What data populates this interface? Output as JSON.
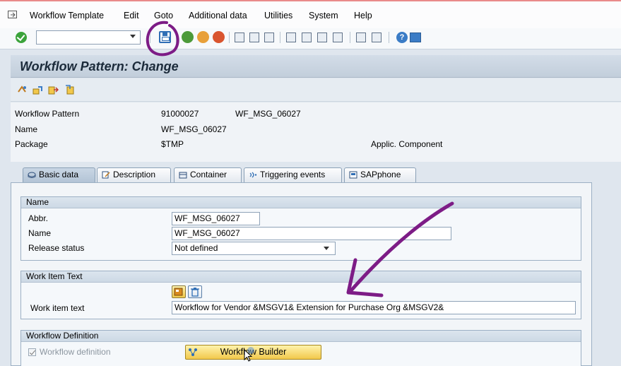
{
  "menubar": {
    "items": [
      "Workflow Template",
      "Edit",
      "Goto",
      "Additional data",
      "Utilities",
      "System",
      "Help"
    ]
  },
  "toolbar": {
    "command_field_value": "",
    "icons": [
      "enter-icon",
      "save-icon",
      "back-icon",
      "exit-icon",
      "cancel-icon",
      "print-icon",
      "find-icon",
      "find-next-icon",
      "first-page-icon",
      "previous-page-icon",
      "next-page-icon",
      "last-page-icon",
      "create-session-icon",
      "shortcut-icon",
      "help-icon",
      "layout-icon"
    ]
  },
  "title": "Workflow Pattern: Change",
  "header": {
    "workflow_pattern_label": "Workflow Pattern",
    "workflow_pattern_id": "91000027",
    "workflow_pattern_abbr": "WF_MSG_06027",
    "name_label": "Name",
    "name_value": "WF_MSG_06027",
    "package_label": "Package",
    "package_value": "$TMP",
    "applic_component_label": "Applic. Component"
  },
  "tabs": [
    {
      "label": "Basic data",
      "active": true
    },
    {
      "label": "Description",
      "active": false
    },
    {
      "label": "Container",
      "active": false
    },
    {
      "label": "Triggering events",
      "active": false
    },
    {
      "label": "SAPphone",
      "active": false
    }
  ],
  "name_group": {
    "title": "Name",
    "abbr_label": "Abbr.",
    "abbr_value": "WF_MSG_06027",
    "name_label": "Name",
    "name_value": "WF_MSG_06027",
    "release_status_label": "Release status",
    "release_status_value": "Not defined"
  },
  "work_item_group": {
    "title": "Work Item Text",
    "work_item_text_label": "Work item text",
    "work_item_text_value": "Workflow for Vendor &MSGV1& Extension for Purchase Org &MSGV2&"
  },
  "workflow_def_group": {
    "title": "Workflow Definition",
    "checkbox_label": "Workflow definition",
    "checkbox_checked": true,
    "builder_button_label": "Workflow Builder"
  },
  "colors": {
    "annotation": "#7d1c86",
    "accent_blue": "#2f6eb5"
  }
}
